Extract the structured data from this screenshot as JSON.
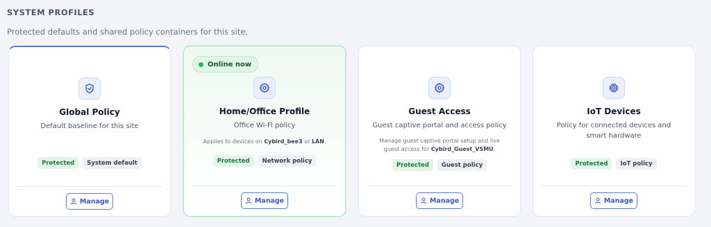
{
  "section": {
    "title": "SYSTEM PROFILES",
    "subtitle": "Protected defaults and shared policy containers for this site."
  },
  "cards": [
    {
      "title": "Global Policy",
      "desc": "Default baseline for this site",
      "icon": "shield-icon",
      "tags": [
        "Protected",
        "System default"
      ],
      "manage_label": "Manage"
    },
    {
      "badge": "Online now",
      "title": "Home/Office Profile",
      "desc": "Office Wi-Fi policy",
      "icon": "gear-icon",
      "note_pre": "Applies to devices on ",
      "note_b1": "Cybird_bee3",
      "note_mid": " or ",
      "note_b2": "LAN",
      "note_end": ".",
      "tags": [
        "Protected",
        "Network policy"
      ],
      "manage_label": "Manage"
    },
    {
      "title": "Guest Access",
      "desc": "Guest captive portal and access policy",
      "icon": "gear-icon",
      "note_pre": "Manage guest captive portal setup and live guest access for ",
      "note_b1": "Cybird_Guest_VSMU",
      "note_end": ".",
      "tags": [
        "Protected",
        "Guest policy"
      ],
      "manage_label": "Manage"
    },
    {
      "title": "IoT Devices",
      "desc": "Policy for connected devices and smart hardware",
      "icon": "chip-icon",
      "tags": [
        "Protected",
        "IoT policy"
      ],
      "manage_label": "Manage"
    }
  ],
  "colors": {
    "accent": "#5b7bd9",
    "online": "#2fb35a",
    "protected_text": "#1f7a3e"
  }
}
